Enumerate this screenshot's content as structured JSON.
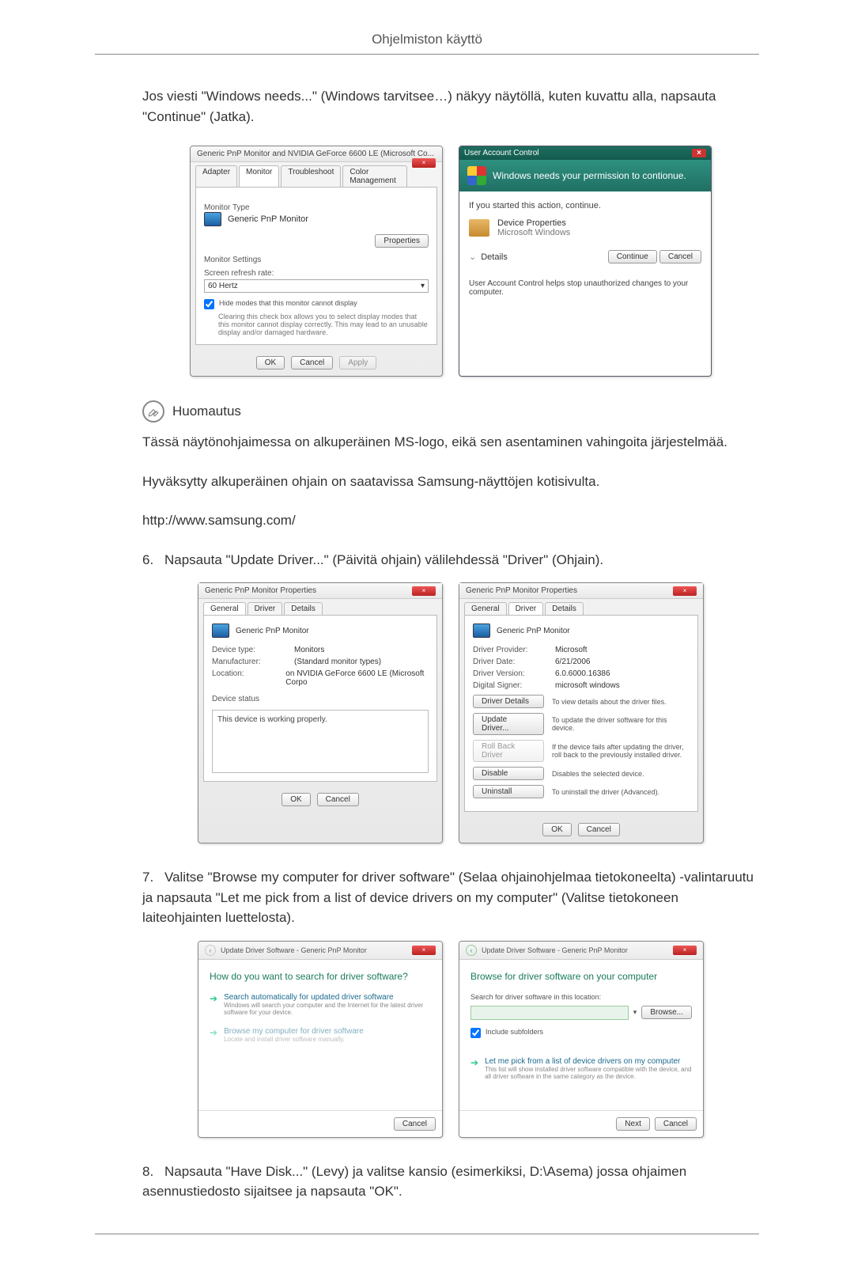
{
  "header": {
    "title": "Ohjelmiston käyttö"
  },
  "intro": "Jos viesti \"Windows needs...\" (Windows tarvitsee…) näkyy näytöllä, kuten kuvattu alla, napsauta \"Continue\" (Jatka).",
  "monitorDialog": {
    "title": "Generic PnP Monitor and NVIDIA GeForce 6600 LE (Microsoft Co...",
    "tabs": {
      "adapter": "Adapter",
      "monitor": "Monitor",
      "troubleshoot": "Troubleshoot",
      "color": "Color Management"
    },
    "typeLabel": "Monitor Type",
    "typeValue": "Generic PnP Monitor",
    "propertiesBtn": "Properties",
    "settingsLabel": "Monitor Settings",
    "refreshLabel": "Screen refresh rate:",
    "refreshValue": "60 Hertz",
    "hideModes": "Hide modes that this monitor cannot display",
    "hideNote": "Clearing this check box allows you to select display modes that this monitor cannot display correctly. This may lead to an unusable display and/or damaged hardware.",
    "ok": "OK",
    "cancel": "Cancel",
    "apply": "Apply"
  },
  "uac": {
    "title": "User Account Control",
    "banner": "Windows needs your permission to contionue.",
    "started": "If you started this action, continue.",
    "propName": "Device Properties",
    "propVendor": "Microsoft Windows",
    "details": "Details",
    "continue": "Continue",
    "cancel": "Cancel",
    "footer": "User Account Control helps stop unauthorized changes to your computer."
  },
  "note": {
    "label": "Huomautus",
    "p1": "Tässä näytönohjaimessa on alkuperäinen MS-logo, eikä sen asentaminen vahingoita järjestelmää.",
    "p2": "Hyväksytty alkuperäinen ohjain on saatavissa Samsung-näyttöjen kotisivulta.",
    "url": "http://www.samsung.com/"
  },
  "step6": "Napsauta \"Update Driver...\" (Päivitä ohjain) välilehdessä \"Driver\" (Ohjain).",
  "propDialogLeft": {
    "title": "Generic PnP Monitor Properties",
    "tabs": {
      "general": "General",
      "driver": "Driver",
      "details": "Details"
    },
    "name": "Generic PnP Monitor",
    "deviceType": {
      "k": "Device type:",
      "v": "Monitors"
    },
    "manufacturer": {
      "k": "Manufacturer:",
      "v": "(Standard monitor types)"
    },
    "location": {
      "k": "Location:",
      "v": "on NVIDIA GeForce 6600 LE (Microsoft Corpo"
    },
    "statusLabel": "Device status",
    "statusText": "This device is working properly.",
    "ok": "OK",
    "cancel": "Cancel"
  },
  "propDialogRight": {
    "title": "Generic PnP Monitor Properties",
    "tabs": {
      "general": "General",
      "driver": "Driver",
      "details": "Details"
    },
    "name": "Generic PnP Monitor",
    "provider": {
      "k": "Driver Provider:",
      "v": "Microsoft"
    },
    "date": {
      "k": "Driver Date:",
      "v": "6/21/2006"
    },
    "version": {
      "k": "Driver Version:",
      "v": "6.0.6000.16386"
    },
    "signer": {
      "k": "Digital Signer:",
      "v": "microsoft windows"
    },
    "btnDetails": {
      "label": "Driver Details",
      "desc": "To view details about the driver files."
    },
    "btnUpdate": {
      "label": "Update Driver...",
      "desc": "To update the driver software for this device."
    },
    "btnRollback": {
      "label": "Roll Back Driver",
      "desc": "If the device fails after updating the driver, roll back to the previously installed driver."
    },
    "btnDisable": {
      "label": "Disable",
      "desc": "Disables the selected device."
    },
    "btnUninstall": {
      "label": "Uninstall",
      "desc": "To uninstall the driver (Advanced)."
    },
    "ok": "OK",
    "cancel": "Cancel"
  },
  "step7": "Valitse \"Browse my computer for driver software\" (Selaa ohjainohjelmaa tietokoneelta) -valintaruutu ja napsauta \"Let me pick from a list of device drivers on my computer\" (Valitse tietokoneen laiteohjainten luettelosta).",
  "wizardLeft": {
    "breadcrumb": "Update Driver Software - Generic PnP Monitor",
    "heading": "How do you want to search for driver software?",
    "opt1Title": "Search automatically for updated driver software",
    "opt1Sub": "Windows will search your computer and the Internet for the latest driver software for your device.",
    "opt2Title": "Browse my computer for driver software",
    "opt2Sub": "Locate and install driver software manually.",
    "cancel": "Cancel"
  },
  "wizardRight": {
    "breadcrumb": "Update Driver Software - Generic PnP Monitor",
    "heading": "Browse for driver software on your computer",
    "searchLabel": "Search for driver software in this location:",
    "browseBtn": "Browse...",
    "includeSub": "Include subfolders",
    "optTitle": "Let me pick from a list of device drivers on my computer",
    "optSub": "This list will show installed driver software compatible with the device, and all driver software in the same category as the device.",
    "next": "Next",
    "cancel": "Cancel"
  },
  "step8": "Napsauta \"Have Disk...\" (Levy) ja valitse kansio (esimerkiksi, D:\\Asema) jossa ohjaimen asennustiedosto sijaitsee ja napsauta \"OK\"."
}
